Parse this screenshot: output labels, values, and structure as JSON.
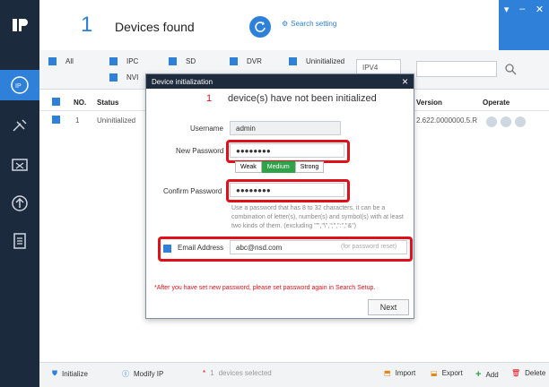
{
  "header": {
    "count": "1",
    "found_label": "Devices found",
    "search_setting": "Search setting"
  },
  "filters": {
    "all": "All",
    "ipc": "IPC",
    "sd": "SD",
    "dvr": "DVR",
    "uninitialized": "Uninitialized",
    "nvr": "NVI",
    "ip_version": "IPV4"
  },
  "table": {
    "headers": [
      "NO.",
      "Status",
      "Version",
      "Operate"
    ],
    "rows": [
      {
        "no": "1",
        "status": "Uninitialized",
        "version": "2.622.0000000.5.R"
      }
    ]
  },
  "modal": {
    "title": "Device initialization",
    "count": "1",
    "message": "device(s) have not been initialized",
    "username_label": "Username",
    "username_value": "admin",
    "new_password_label": "New Password",
    "new_password_value": "●●●●●●●●",
    "strength": [
      "Weak",
      "Medium",
      "Strong"
    ],
    "confirm_password_label": "Confirm Password",
    "confirm_password_value": "●●●●●●●●",
    "hint": "Use a password that has 8 to 32 characters, it can be a combination of letter(s), number(s) and symbol(s) with at least two kinds of them. (excluding \"'\",\"\\\",\";\",\":\",\"&\")",
    "email_label": "Email Address",
    "email_value": "abc@nsd.com",
    "email_hint": "(for password reset)",
    "note": "*After you have set new password, please set password again in Search Setup.",
    "next": "Next"
  },
  "footer": {
    "initialize": "Initialize",
    "modify_ip": "Modify IP",
    "selected_count": "1",
    "selected_label": "devices selected",
    "import": "Import",
    "export": "Export",
    "add": "Add",
    "delete": "Delete"
  },
  "colors": {
    "accent": "#2e80d8",
    "highlight": "#e0101b",
    "sidebar": "#1b2a3d",
    "strength_on": "#2fa24a"
  }
}
